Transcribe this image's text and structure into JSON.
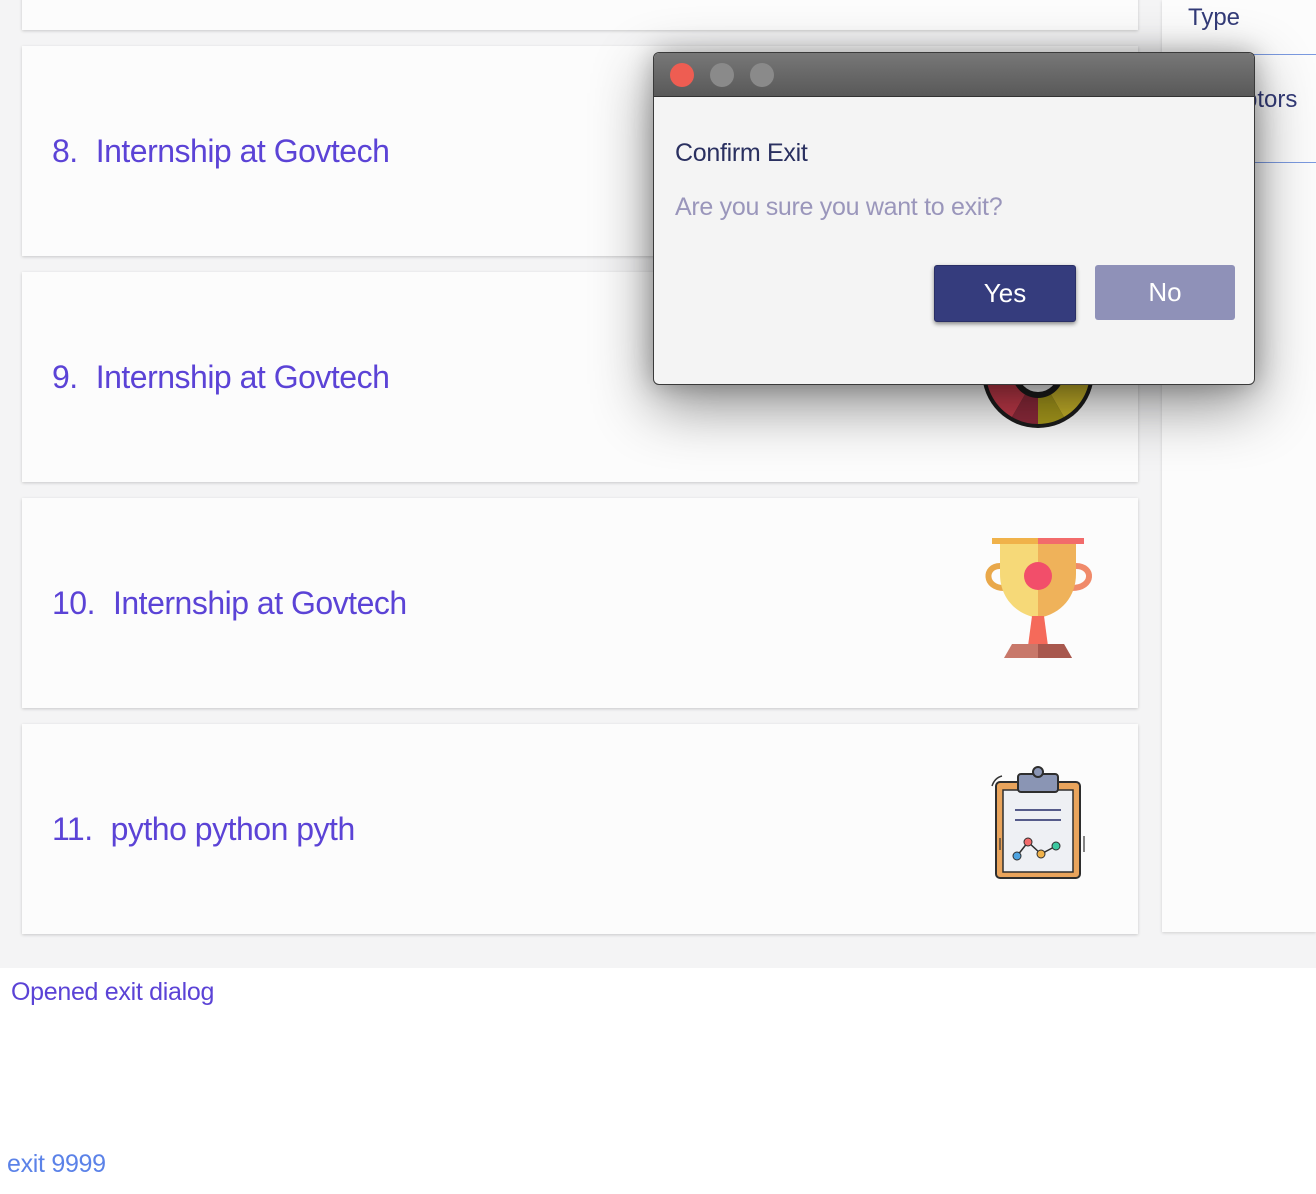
{
  "cards": [
    {
      "index": "8.",
      "title": "Internship at Govtech",
      "icon": "partial-icon"
    },
    {
      "index": "9.",
      "title": "Internship at Govtech",
      "icon": "color-wheel-icon"
    },
    {
      "index": "10.",
      "title": "Internship at Govtech",
      "icon": "trophy-icon"
    },
    {
      "index": "11.",
      "title": "pytho python pyth",
      "icon": "clipboard-chart-icon"
    }
  ],
  "side_panel": {
    "items": [
      {
        "label": "Type"
      },
      {
        "label": "ptors"
      }
    ]
  },
  "dialog": {
    "heading": "Confirm Exit",
    "message": "Are you sure you want to exit?",
    "yes_label": "Yes",
    "no_label": "No"
  },
  "result_display": {
    "text": "Opened exit dialog"
  },
  "command_box": {
    "value": "exit 9999"
  },
  "colors": {
    "accent_purple": "#5b43d6",
    "navy": "#353c7d",
    "muted_button": "#8f91b8",
    "close_red": "#ee5d52"
  }
}
